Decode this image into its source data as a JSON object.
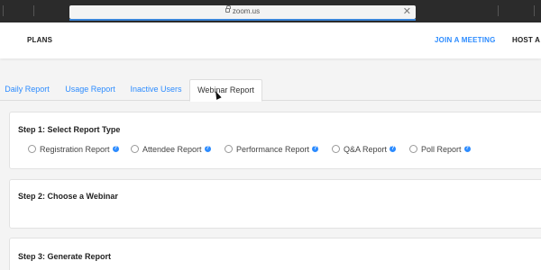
{
  "browser": {
    "url": "zoom.us",
    "clear_glyph": "✕"
  },
  "nav": {
    "plans": "PLANS",
    "join": "JOIN A MEETING",
    "host": "HOST A M"
  },
  "tabs": [
    {
      "label": "Daily Report"
    },
    {
      "label": "Usage Report"
    },
    {
      "label": "Inactive Users"
    },
    {
      "label": "Webinar Report",
      "active": true
    }
  ],
  "step1": {
    "title": "Step 1: Select Report Type",
    "options": [
      {
        "label": "Registration Report"
      },
      {
        "label": "Attendee Report"
      },
      {
        "label": "Performance Report"
      },
      {
        "label": "Q&A Report"
      },
      {
        "label": "Poll Report"
      }
    ],
    "help_glyph": "?"
  },
  "step2": {
    "title": "Step 2: Choose a Webinar"
  },
  "step3": {
    "title": "Step 3: Generate Report"
  },
  "colors": {
    "accent": "#2d8cff",
    "browser_chrome": "#2b2b2b",
    "page_bg": "#f4f4f4"
  }
}
